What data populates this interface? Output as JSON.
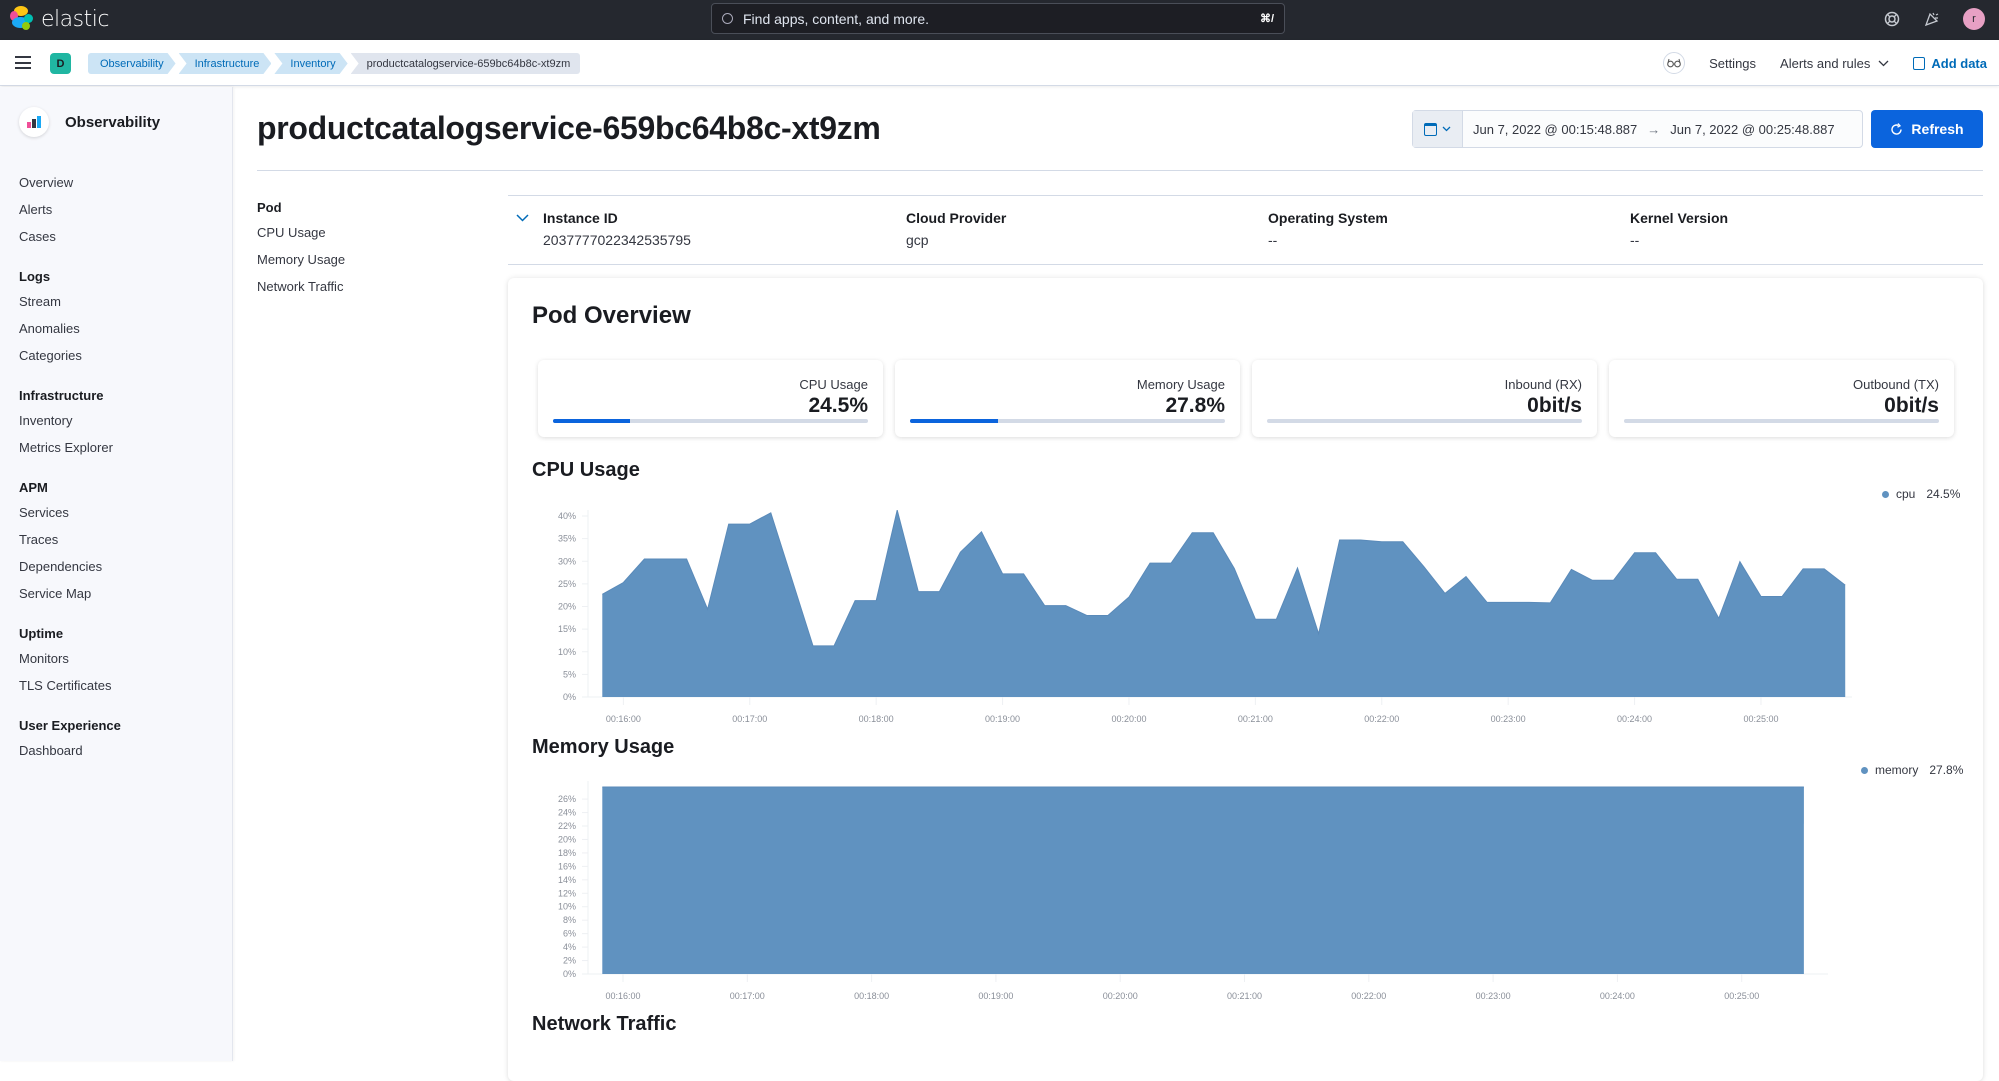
{
  "header": {
    "brand": "elastic",
    "search_placeholder": "Find apps, content, and more.",
    "search_shortcut": "⌘/",
    "icons": [
      "help-icon",
      "newsfeed-icon"
    ],
    "avatar_initial": "r"
  },
  "subbar": {
    "space_initial": "D",
    "breadcrumbs": [
      "Observability",
      "Infrastructure",
      "Inventory",
      "productcatalogservice-659bc64b8c-xt9zm"
    ],
    "settings": "Settings",
    "alerts_rules": "Alerts and rules",
    "add_data": "Add data"
  },
  "sidebar": {
    "title": "Observability",
    "top_items": [
      "Overview",
      "Alerts",
      "Cases"
    ],
    "groups": [
      {
        "title": "Logs",
        "items": [
          "Stream",
          "Anomalies",
          "Categories"
        ]
      },
      {
        "title": "Infrastructure",
        "items": [
          "Inventory",
          "Metrics Explorer"
        ]
      },
      {
        "title": "APM",
        "items": [
          "Services",
          "Traces",
          "Dependencies",
          "Service Map"
        ]
      },
      {
        "title": "Uptime",
        "items": [
          "Monitors",
          "TLS Certificates"
        ]
      },
      {
        "title": "User Experience",
        "items": [
          "Dashboard"
        ]
      }
    ]
  },
  "page": {
    "title": "productcatalogservice-659bc64b8c-xt9zm",
    "date_start": "Jun 7, 2022 @ 00:15:48.887",
    "date_arrow": "→",
    "date_end": "Jun 7, 2022 @ 00:25:48.887",
    "refresh": "Refresh"
  },
  "page_nav": {
    "title": "Pod",
    "items": [
      "CPU Usage",
      "Memory Usage",
      "Network Traffic"
    ]
  },
  "metadata": [
    {
      "label": "Instance ID",
      "value": "2037777022342535795"
    },
    {
      "label": "Cloud Provider",
      "value": "gcp"
    },
    {
      "label": "Operating System",
      "value": "--"
    },
    {
      "label": "Kernel Version",
      "value": "--"
    }
  ],
  "overview": {
    "title": "Pod Overview",
    "stats": [
      {
        "label": "CPU Usage",
        "value": "24.5%",
        "progress": 0.245
      },
      {
        "label": "Memory Usage",
        "value": "27.8%",
        "progress": 0.278
      },
      {
        "label": "Inbound (RX)",
        "value": "0bit/s",
        "progress": 0
      },
      {
        "label": "Outbound (TX)",
        "value": "0bit/s",
        "progress": 0
      }
    ]
  },
  "sections": {
    "cpu": "CPU Usage",
    "memory": "Memory Usage",
    "network": "Network Traffic"
  },
  "colors": {
    "series": "#6092c0",
    "primary": "#0b64dd",
    "header_bg": "#25282f"
  },
  "chart_data": [
    {
      "type": "area",
      "title": "CPU Usage",
      "xlabel": "",
      "ylabel": "",
      "x_start": "00:15:50",
      "x_interval_seconds": 10,
      "x_ticks": [
        "00:16:00",
        "00:17:00",
        "00:18:00",
        "00:19:00",
        "00:20:00",
        "00:21:00",
        "00:22:00",
        "00:23:00",
        "00:24:00",
        "00:25:00"
      ],
      "y_ticks": [
        "0%",
        "5%",
        "10%",
        "15%",
        "20%",
        "25%",
        "30%",
        "35%",
        "40%"
      ],
      "ylim": [
        0,
        40
      ],
      "legend": {
        "position": "top-right",
        "entries": [
          {
            "name": "cpu",
            "value": "24.5%"
          }
        ]
      },
      "series": [
        {
          "name": "cpu",
          "values": [
            22.7,
            25.3,
            30.5,
            30.5,
            30.5,
            19.4,
            38.2,
            38.2,
            40.7,
            26.0,
            11.3,
            11.3,
            21.3,
            21.3,
            41.3,
            23.3,
            23.3,
            32.0,
            36.5,
            27.2,
            27.2,
            20.2,
            20.2,
            18.0,
            18.0,
            22.1,
            29.6,
            29.6,
            36.3,
            36.3,
            28.4,
            17.2,
            17.2,
            28.5,
            14.0,
            34.7,
            34.7,
            34.3,
            34.3,
            28.8,
            22.9,
            26.6,
            20.9,
            20.9,
            20.9,
            20.8,
            28.2,
            25.8,
            25.8,
            31.9,
            31.9,
            26.0,
            26.0,
            17.4,
            29.9,
            22.2,
            22.2,
            28.3,
            28.3,
            24.7
          ]
        }
      ]
    },
    {
      "type": "area",
      "title": "Memory Usage",
      "xlabel": "",
      "ylabel": "",
      "x_start": "00:15:50",
      "x_interval_seconds": 10,
      "x_ticks": [
        "00:16:00",
        "00:17:00",
        "00:18:00",
        "00:19:00",
        "00:20:00",
        "00:21:00",
        "00:22:00",
        "00:23:00",
        "00:24:00",
        "00:25:00"
      ],
      "y_ticks": [
        "0%",
        "2%",
        "4%",
        "6%",
        "8%",
        "10%",
        "12%",
        "14%",
        "16%",
        "18%",
        "20%",
        "22%",
        "24%",
        "26%"
      ],
      "ylim": [
        0,
        27.8
      ],
      "legend": {
        "position": "top-right",
        "entries": [
          {
            "name": "memory",
            "value": "27.8%"
          }
        ]
      },
      "series": [
        {
          "name": "memory",
          "values": [
            27.8,
            27.8,
            27.8,
            27.8,
            27.8,
            27.8,
            27.8,
            27.8,
            27.8,
            27.8,
            27.8,
            27.8,
            27.8,
            27.8,
            27.8,
            27.8,
            27.8,
            27.8,
            27.8,
            27.8,
            27.8,
            27.8,
            27.8,
            27.8,
            27.8,
            27.8,
            27.8,
            27.8,
            27.8,
            27.8,
            27.8,
            27.8,
            27.8,
            27.8,
            27.8,
            27.8,
            27.8,
            27.8,
            27.8,
            27.8,
            27.8,
            27.8,
            27.8,
            27.8,
            27.8,
            27.8,
            27.8,
            27.8,
            27.8,
            27.8,
            27.8,
            27.8,
            27.8,
            27.8,
            27.8,
            27.8,
            27.8,
            27.8,
            27.8
          ]
        }
      ]
    }
  ]
}
